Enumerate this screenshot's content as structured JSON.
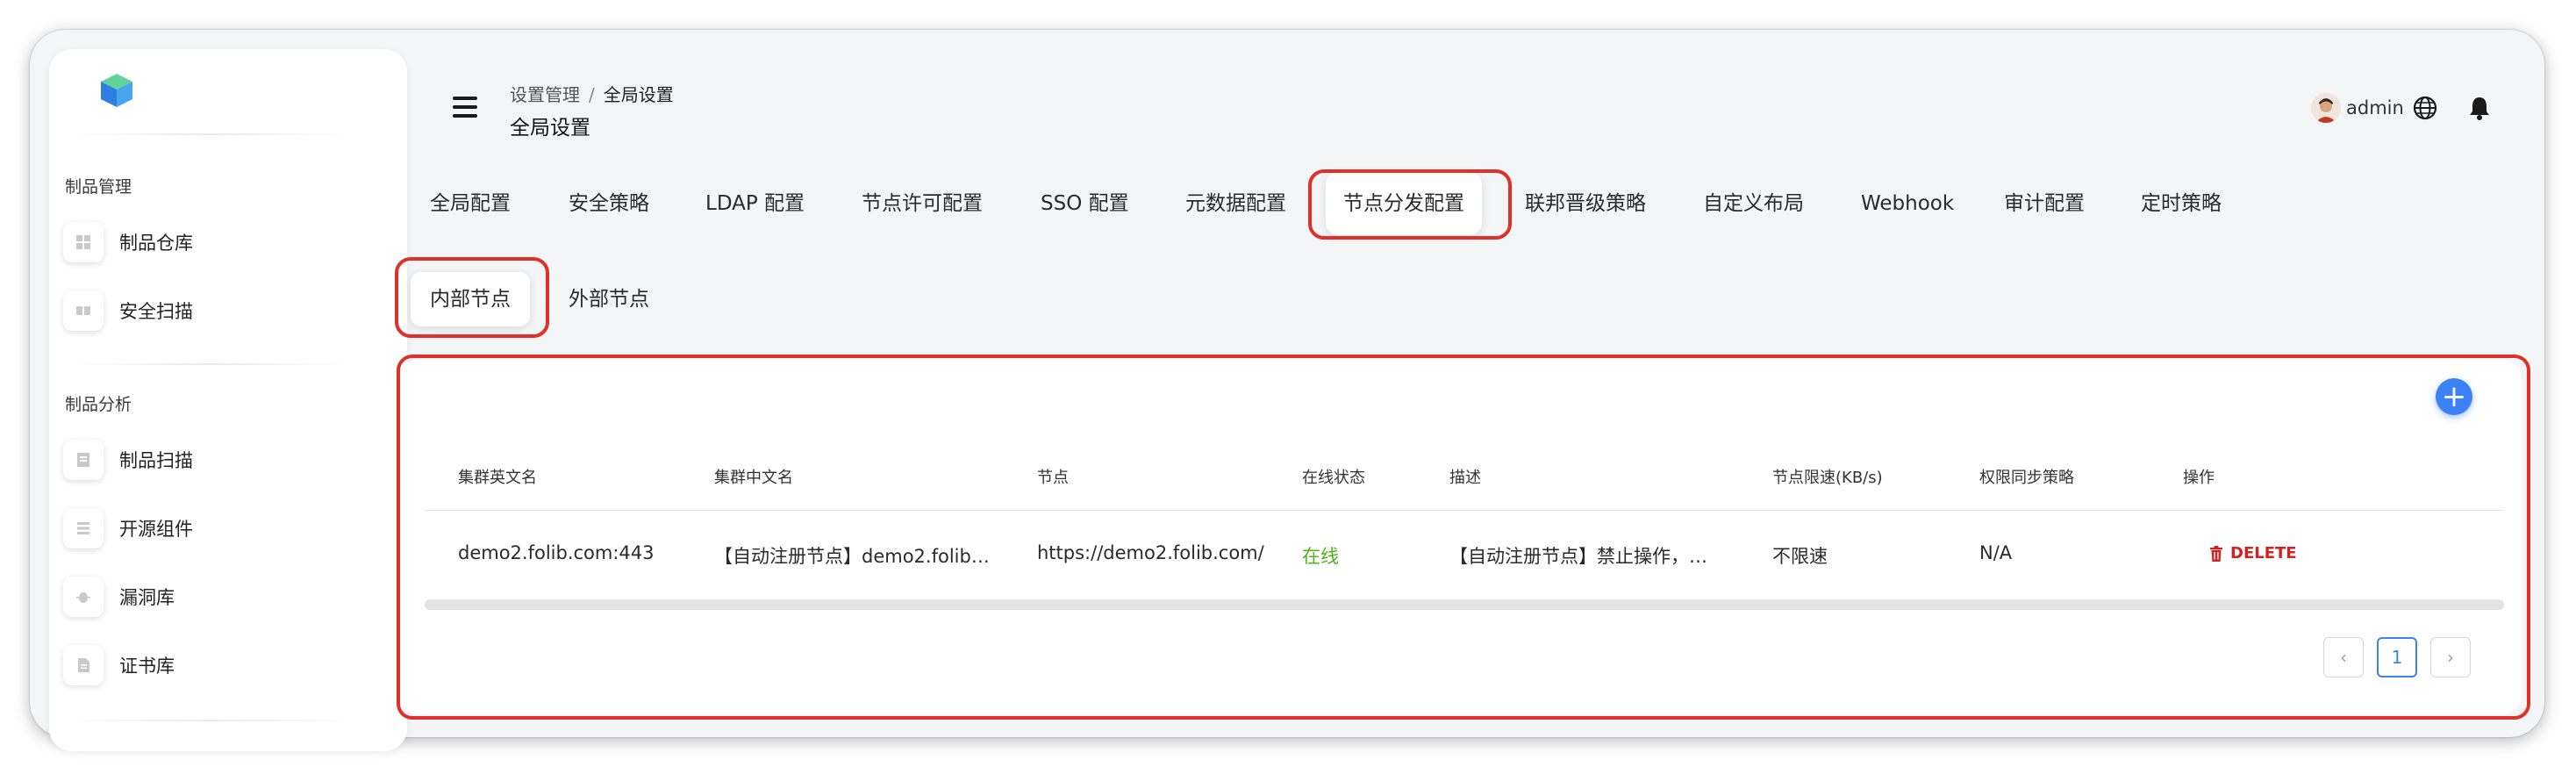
{
  "sidebar": {
    "sections": [
      {
        "title": "制品管理",
        "items": [
          {
            "label": "制品仓库",
            "icon": "grid-icon"
          },
          {
            "label": "安全扫描",
            "icon": "scan-book-icon"
          }
        ]
      },
      {
        "title": "制品分析",
        "items": [
          {
            "label": "制品扫描",
            "icon": "scan-doc-icon"
          },
          {
            "label": "开源组件",
            "icon": "list-icon"
          },
          {
            "label": "漏洞库",
            "icon": "bug-icon"
          },
          {
            "label": "证书库",
            "icon": "certificate-icon"
          }
        ]
      }
    ]
  },
  "header": {
    "breadcrumb": [
      "设置管理",
      "全局设置"
    ],
    "breadcrumb_separator": "/",
    "title": "全局设置",
    "username": "admin"
  },
  "tabs": [
    "全局配置",
    "安全策略",
    "LDAP 配置",
    "节点许可配置",
    "SSO 配置",
    "元数据配置",
    "节点分发配置",
    "联邦晋级策略",
    "自定义布局",
    "Webhook",
    "审计配置",
    "定时策略"
  ],
  "active_tab": "节点分发配置",
  "subtabs": [
    "内部节点",
    "外部节点"
  ],
  "active_subtab": "内部节点",
  "table": {
    "columns": [
      "集群英文名",
      "集群中文名",
      "节点",
      "在线状态",
      "描述",
      "节点限速(KB/s)",
      "权限同步策略",
      "操作"
    ],
    "rows": [
      {
        "en_name": "demo2.folib.com:443",
        "cn_name": "【自动注册节点】demo2.folib…",
        "node": "https://demo2.folib.com/",
        "status": "在线",
        "description": "【自动注册节点】禁止操作，…",
        "speed_limit": "不限速",
        "sync_policy": "N/A",
        "action": "DELETE"
      }
    ]
  },
  "pagination": {
    "current": "1",
    "prev": "‹",
    "next": "›"
  },
  "colors": {
    "accent": "#3b82f6",
    "highlight": "#e0302a",
    "online": "#52b41a",
    "delete": "#d32020",
    "logo_green": "#3fbf73",
    "logo_blue": "#2f7fe0"
  }
}
